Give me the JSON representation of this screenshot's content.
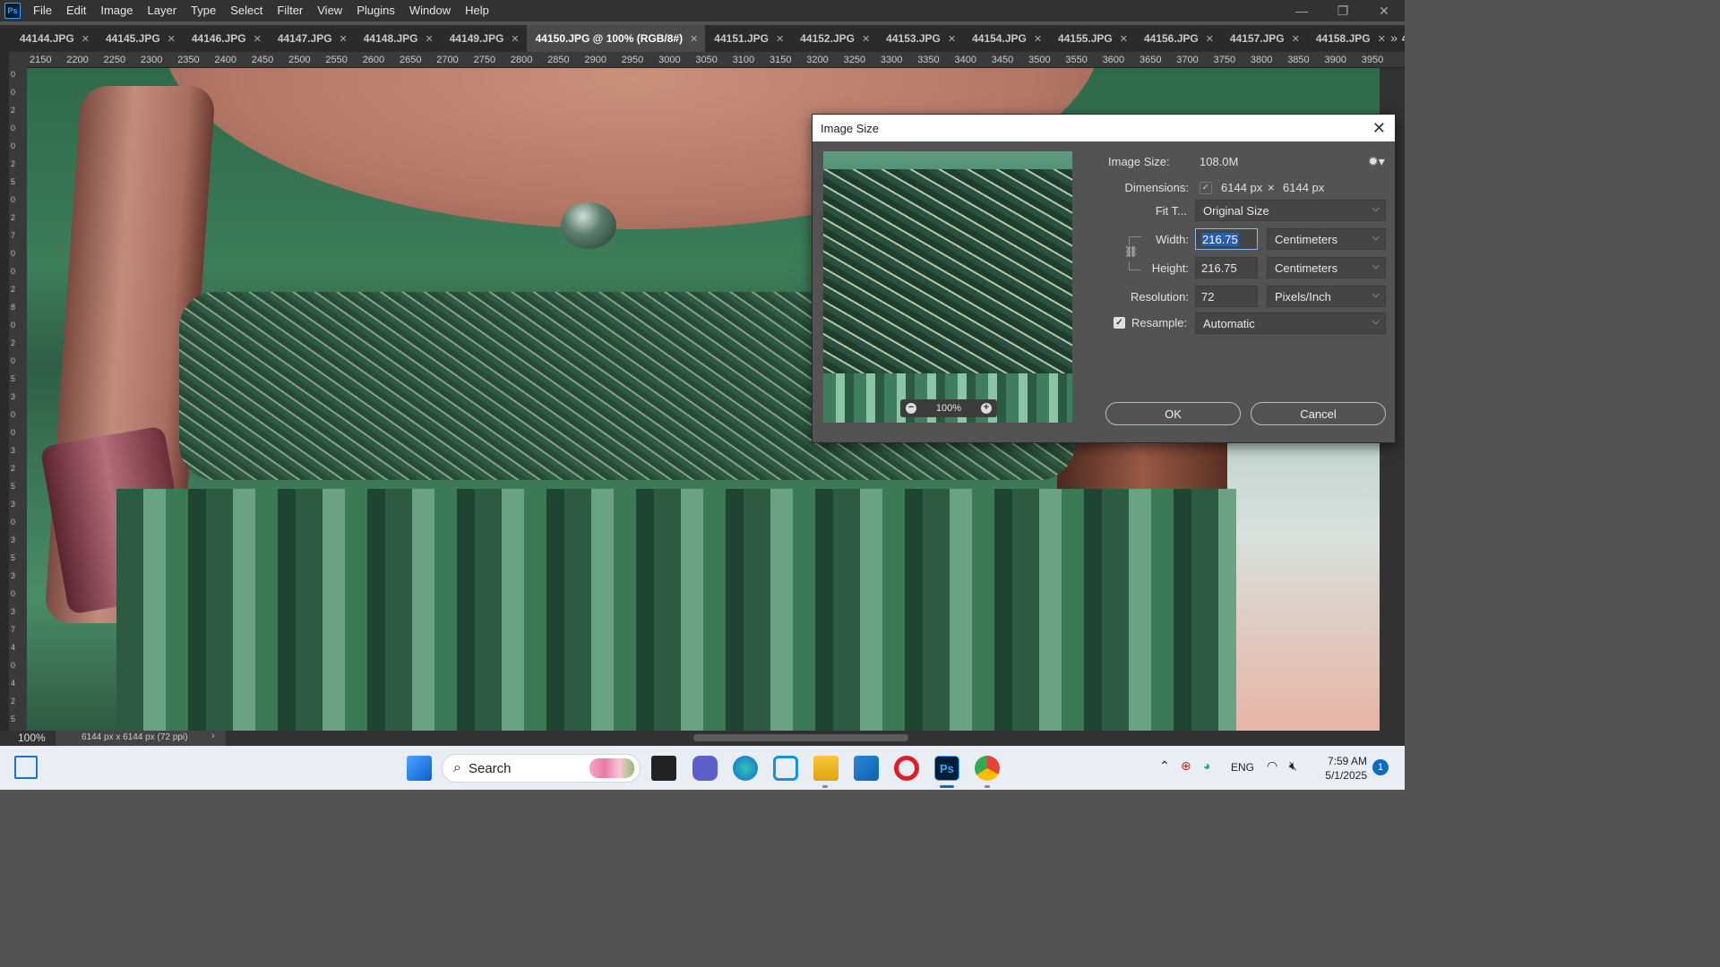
{
  "menu": [
    "File",
    "Edit",
    "Image",
    "Layer",
    "Type",
    "Select",
    "Filter",
    "View",
    "Plugins",
    "Window",
    "Help"
  ],
  "app_icon": "Ps",
  "window_controls": {
    "minimize": "—",
    "restore": "❐",
    "close": "✕"
  },
  "tabs": [
    {
      "label": "44144.JPG",
      "active": false
    },
    {
      "label": "44145.JPG",
      "active": false
    },
    {
      "label": "44146.JPG",
      "active": false
    },
    {
      "label": "44147.JPG",
      "active": false
    },
    {
      "label": "44148.JPG",
      "active": false
    },
    {
      "label": "44149.JPG",
      "active": false
    },
    {
      "label": "44150.JPG @ 100% (RGB/8#)",
      "active": true
    },
    {
      "label": "44151.JPG",
      "active": false
    },
    {
      "label": "44152.JPG",
      "active": false
    },
    {
      "label": "44153.JPG",
      "active": false
    },
    {
      "label": "44154.JPG",
      "active": false
    },
    {
      "label": "44155.JPG",
      "active": false
    },
    {
      "label": "44156.JPG",
      "active": false
    },
    {
      "label": "44157.JPG",
      "active": false
    },
    {
      "label": "44158.JPG",
      "active": false
    },
    {
      "label": "441",
      "active": false
    }
  ],
  "tab_more": "»",
  "ruler_h": [
    "2150",
    "2200",
    "2250",
    "2300",
    "2350",
    "2400",
    "2450",
    "2500",
    "2550",
    "2600",
    "2650",
    "2700",
    "2750",
    "2800",
    "2850",
    "2900",
    "2950",
    "3000",
    "3050",
    "3100",
    "3150",
    "3200",
    "3250",
    "3300",
    "3350",
    "3400",
    "3450",
    "3500",
    "3550",
    "3600",
    "3650",
    "3700",
    "3750",
    "3800",
    "3850",
    "3900",
    "3950"
  ],
  "ruler_v": [
    "0",
    "0",
    "2",
    "0",
    "0",
    "2",
    "5",
    "0",
    "2",
    "7",
    "0",
    "0",
    "2",
    "8",
    "0",
    "2",
    "0",
    "5",
    "3",
    "0",
    "0",
    "3",
    "2",
    "5",
    "3",
    "0",
    "3",
    "5",
    "3",
    "0",
    "3",
    "7",
    "4",
    "0",
    "4",
    "2",
    "5"
  ],
  "dialog": {
    "title": "Image Size",
    "close": "✕",
    "image_size_label": "Image Size:",
    "image_size_value": "108.0M",
    "dimensions_label": "Dimensions:",
    "dimensions_w": "6144 px",
    "dimensions_x": "×",
    "dimensions_h": "6144 px",
    "fit_to_label": "Fit T...",
    "fit_to_value": "Original Size",
    "width_label": "Width:",
    "width_value": "216.75",
    "width_unit": "Centimeters",
    "height_label": "Height:",
    "height_value": "216.75",
    "height_unit": "Centimeters",
    "resolution_label": "Resolution:",
    "resolution_value": "72",
    "resolution_unit": "Pixels/Inch",
    "resample_label": "Resample:",
    "resample_checked": true,
    "resample_value": "Automatic",
    "preview_zoom": "100%",
    "ok_label": "OK",
    "cancel_label": "Cancel"
  },
  "status": {
    "zoom": "100%",
    "doc_info": "6144 px x 6144 px (72 ppi)"
  },
  "taskbar": {
    "search_placeholder": "Search",
    "language": "ENG",
    "time": "7:59 AM",
    "date": "5/1/2025",
    "notifications": "1"
  },
  "colors": {
    "ps_bg": "#535353",
    "menubar": "#323232",
    "accent": "#31a8ff",
    "taskbar": "#e9eef4",
    "selection": "#2a5ea8"
  }
}
